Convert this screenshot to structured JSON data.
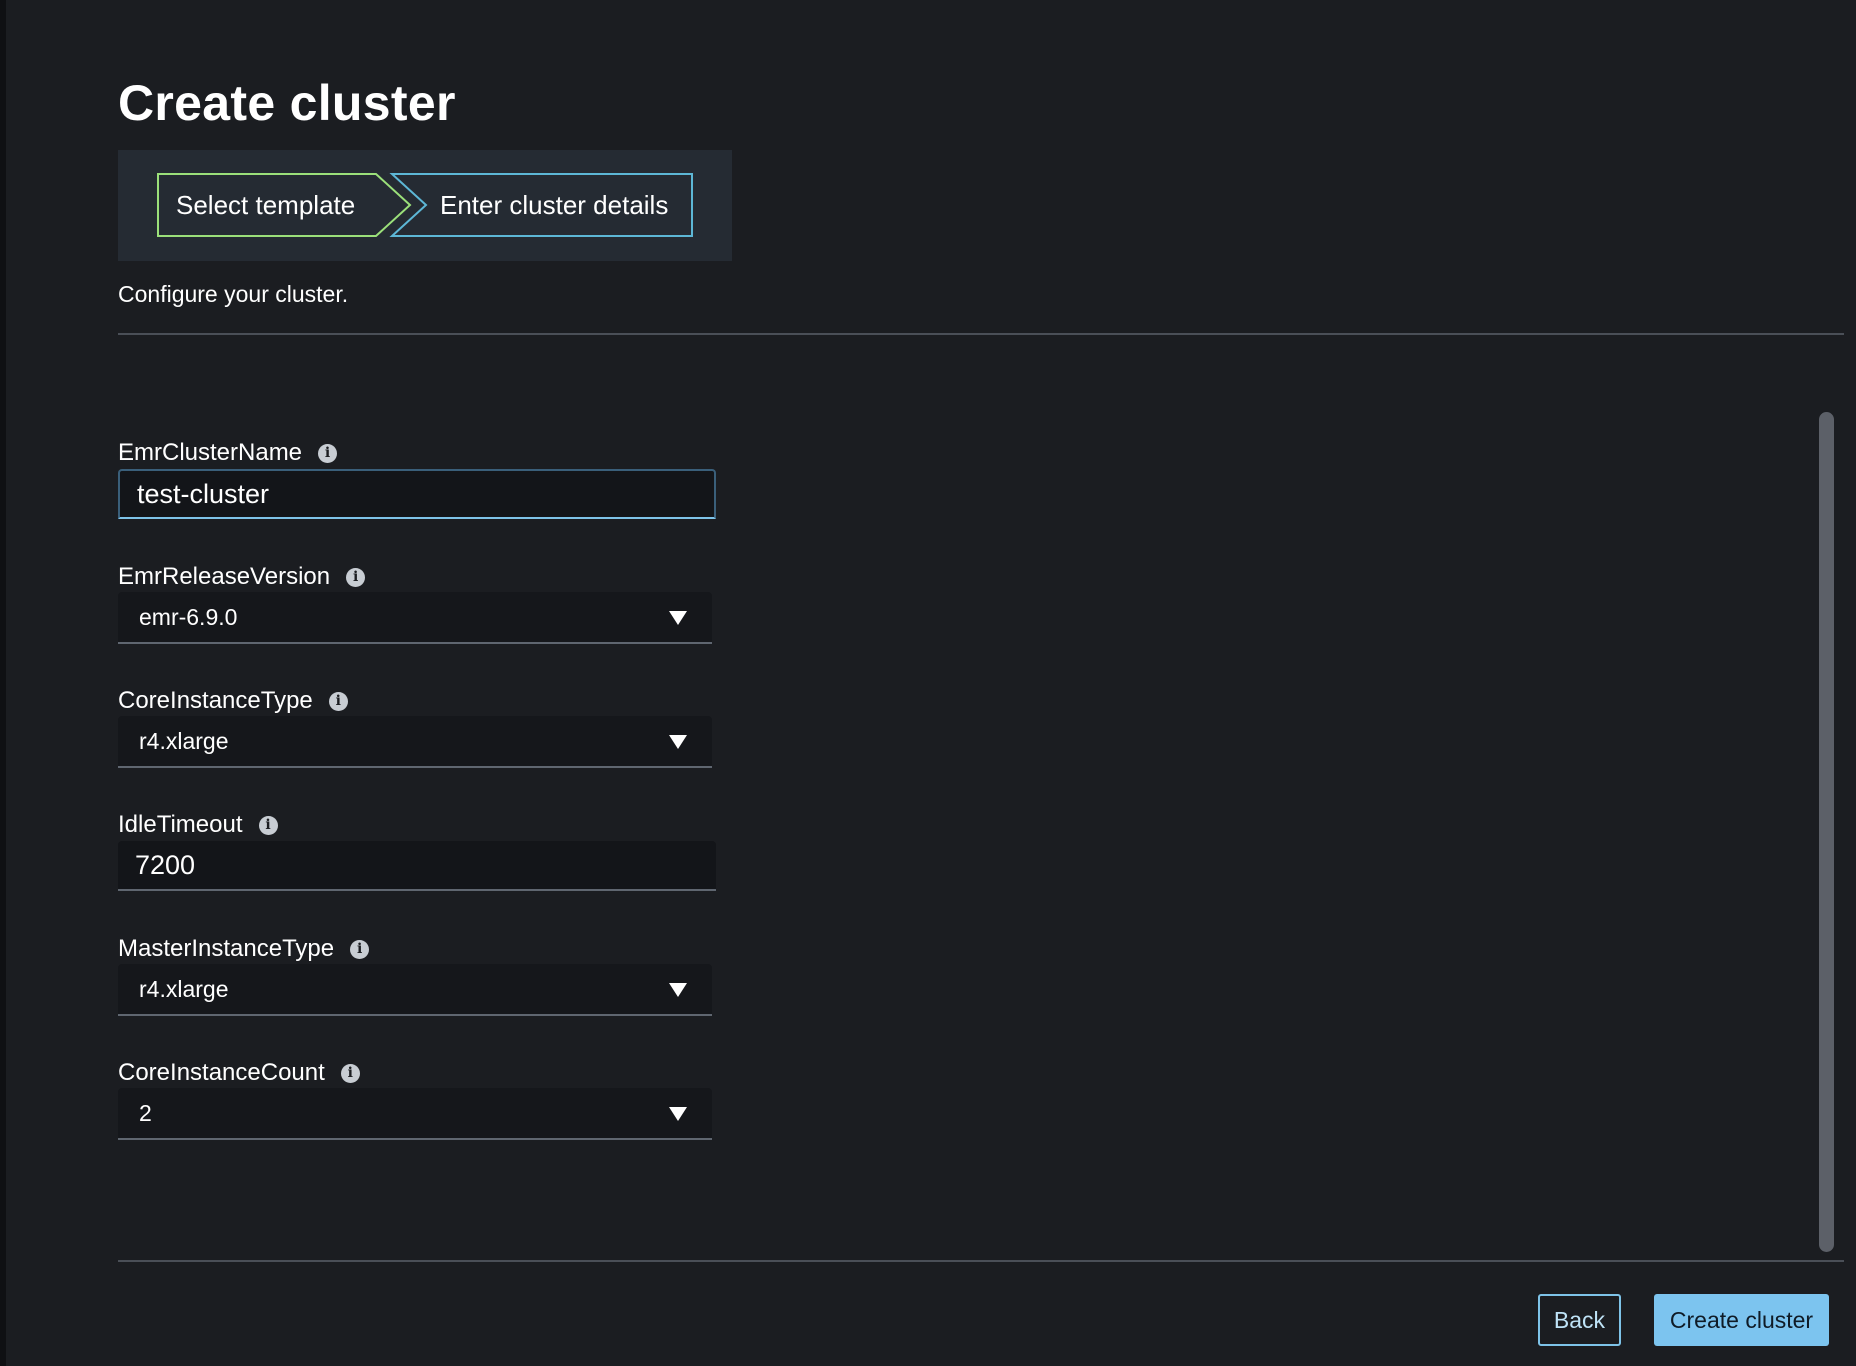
{
  "page": {
    "title": "Create cluster",
    "subtitle": "Configure your cluster."
  },
  "stepper": {
    "steps": [
      {
        "label": "Select template",
        "state": "completed",
        "color": "#9be07a"
      },
      {
        "label": "Enter cluster details",
        "state": "current",
        "color": "#5db7d6"
      }
    ]
  },
  "form": {
    "fields": [
      {
        "label": "EmrClusterName",
        "type": "text",
        "value": "test-cluster",
        "icon": "info-icon"
      },
      {
        "label": "EmrReleaseVersion",
        "type": "select",
        "value": "emr-6.9.0",
        "icon": "info-icon"
      },
      {
        "label": "CoreInstanceType",
        "type": "select",
        "value": "r4.xlarge",
        "icon": "info-icon"
      },
      {
        "label": "IdleTimeout",
        "type": "text",
        "value": "7200",
        "icon": "info-icon"
      },
      {
        "label": "MasterInstanceType",
        "type": "select",
        "value": "r4.xlarge",
        "icon": "info-icon"
      },
      {
        "label": "CoreInstanceCount",
        "type": "select",
        "value": "2",
        "icon": "info-icon"
      }
    ]
  },
  "footer": {
    "back_label": "Back",
    "create_label": "Create cluster"
  },
  "colors": {
    "background": "#1b1d21",
    "accent": "#7cc4ef",
    "step_done": "#9be07a",
    "step_current": "#5db7d6"
  }
}
